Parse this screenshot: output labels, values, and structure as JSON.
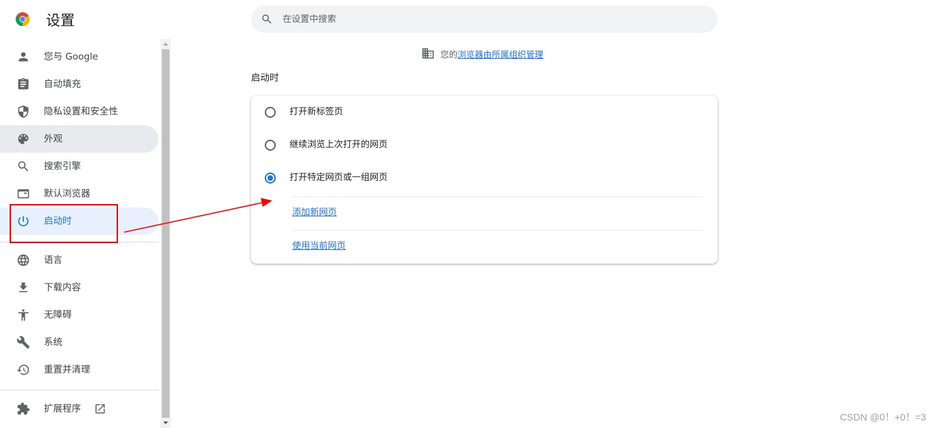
{
  "header": {
    "title": "设置",
    "search_placeholder": "在设置中搜索"
  },
  "sidebar": {
    "items": [
      {
        "label": "您与 Google",
        "icon": "person-icon"
      },
      {
        "label": "自动填充",
        "icon": "clipboard-icon"
      },
      {
        "label": "隐私设置和安全性",
        "icon": "shield-icon"
      },
      {
        "label": "外观",
        "icon": "palette-icon",
        "state": "hover"
      },
      {
        "label": "搜索引擎",
        "icon": "search-icon"
      },
      {
        "label": "默认浏览器",
        "icon": "browser-icon"
      },
      {
        "label": "启动时",
        "icon": "power-icon",
        "state": "selected"
      },
      {
        "label": "语言",
        "icon": "globe-icon"
      },
      {
        "label": "下载内容",
        "icon": "download-icon"
      },
      {
        "label": "无障碍",
        "icon": "accessibility-icon"
      },
      {
        "label": "系统",
        "icon": "wrench-icon"
      },
      {
        "label": "重置并清理",
        "icon": "restore-icon"
      },
      {
        "label": "扩展程序",
        "icon": "puzzle-icon"
      }
    ]
  },
  "managed": {
    "prefix": "您的",
    "link": "浏览器由所属组织管理"
  },
  "startup": {
    "section_title": "启动时",
    "options": [
      {
        "label": "打开新标签页",
        "checked": false
      },
      {
        "label": "继续浏览上次打开的网页",
        "checked": false
      },
      {
        "label": "打开特定网页或一组网页",
        "checked": true
      }
    ],
    "add_page_link": "添加新网页",
    "use_current_link": "使用当前网页"
  },
  "watermark": "CSDN @0！+0！=3",
  "colors": {
    "accent": "#1a73e8",
    "selected_bg": "#e8f0fe",
    "hover_bg": "#e8eaed",
    "annotation": "#ff0000"
  }
}
